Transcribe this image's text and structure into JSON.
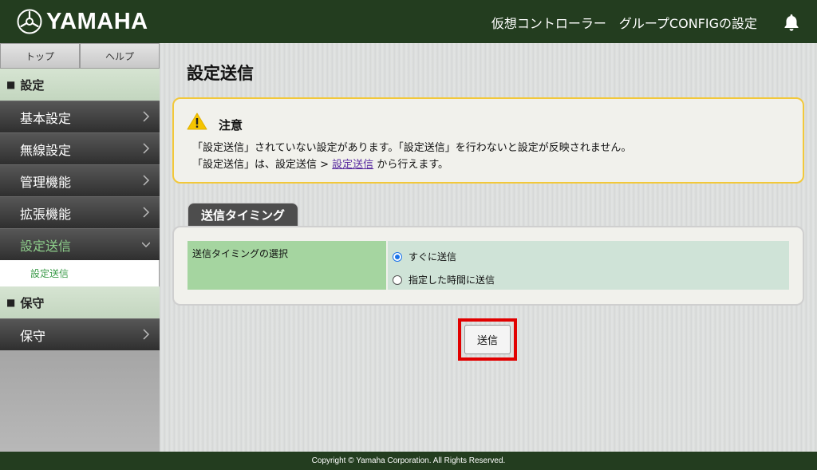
{
  "header": {
    "brand": "YAMAHA",
    "title": "仮想コントローラー　グループCONFIGの設定"
  },
  "sidebar": {
    "top_tabs": [
      "トップ",
      "ヘルプ"
    ],
    "section_settings": "設定",
    "items": [
      {
        "label": "基本設定"
      },
      {
        "label": "無線設定"
      },
      {
        "label": "管理機能"
      },
      {
        "label": "拡張機能"
      },
      {
        "label": "設定送信"
      }
    ],
    "sub_item": "設定送信",
    "section_maintenance": "保守",
    "maintenance_item": "保守"
  },
  "main": {
    "page_title": "設定送信",
    "notice": {
      "title": "注意",
      "line1": "「設定送信」されていない設定があります。「設定送信」を行わないと設定が反映されません。",
      "line2_prefix": "「設定送信」は、設定送信 > ",
      "line2_link": "設定送信",
      "line2_suffix": " から行えます。"
    },
    "timing_tab": "送信タイミング",
    "timing_label": "送信タイミングの選択",
    "options": [
      {
        "label": "すぐに送信",
        "checked": true
      },
      {
        "label": "指定した時間に送信",
        "checked": false
      }
    ],
    "send_button": "送信"
  },
  "footer": {
    "copyright": "Copyright © Yamaha Corporation. All Rights Reserved."
  },
  "colors": {
    "header_bg": "#233d1f",
    "accent_green": "#8fd08c",
    "warning_border": "#f2c83a",
    "highlight_red": "#e10000"
  }
}
